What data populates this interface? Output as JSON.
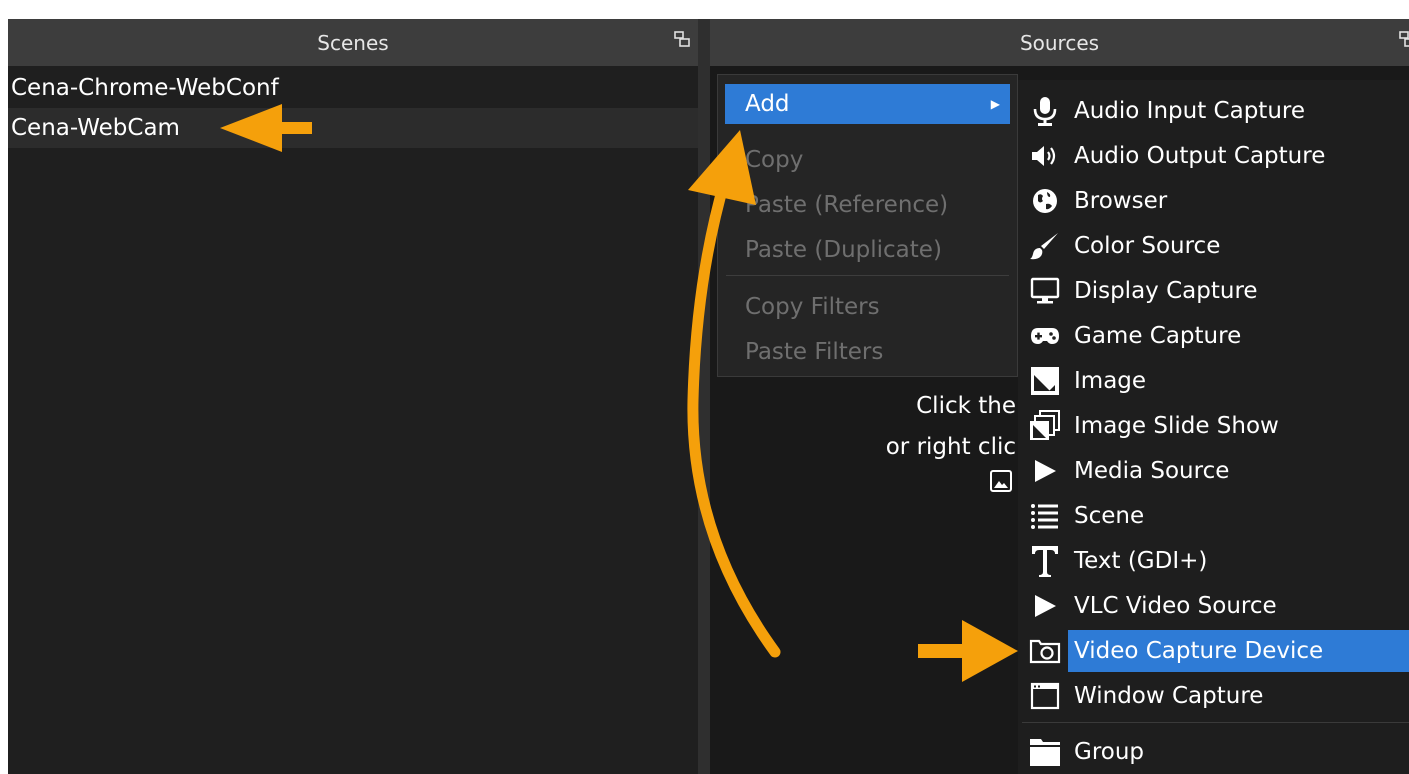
{
  "scenes": {
    "title": "Scenes",
    "items": [
      "Cena-Chrome-WebConf",
      "Cena-WebCam"
    ]
  },
  "sources": {
    "title": "Sources",
    "hint_line1": "Click the",
    "hint_line2": "or right clic"
  },
  "context_menu": {
    "add": "Add",
    "copy": "Copy",
    "paste_reference": "Paste (Reference)",
    "paste_duplicate": "Paste (Duplicate)",
    "copy_filters": "Copy Filters",
    "paste_filters": "Paste Filters"
  },
  "add_submenu": {
    "items": [
      "Audio Input Capture",
      "Audio Output Capture",
      "Browser",
      "Color Source",
      "Display Capture",
      "Game Capture",
      "Image",
      "Image Slide Show",
      "Media Source",
      "Scene",
      "Text (GDI+)",
      "VLC Video Source",
      "Video Capture Device",
      "Window Capture",
      "Group"
    ]
  },
  "colors": {
    "accent": "#2e7bd6",
    "annotation_arrow": "#f5a00b",
    "panel_bg": "#1f1f1f",
    "header_bg": "#3d3d3d"
  }
}
